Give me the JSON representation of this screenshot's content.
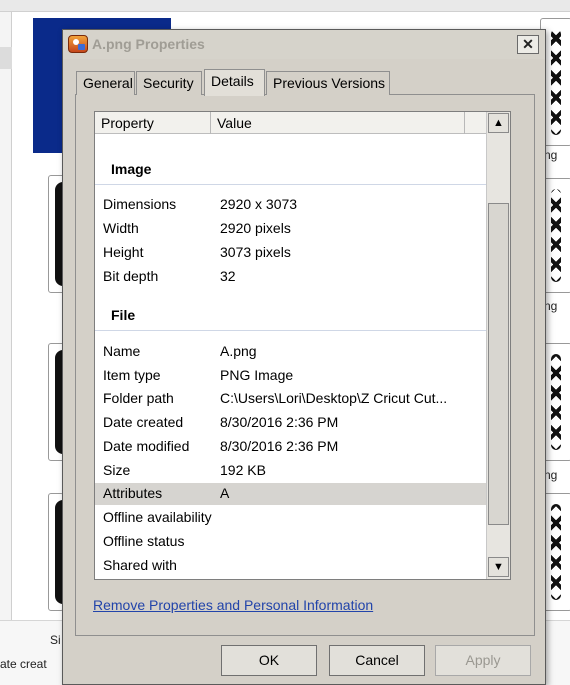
{
  "background": {
    "captions": [
      "ng",
      "ng",
      "ng"
    ],
    "bottom_left": [
      "Si",
      "ate creat"
    ]
  },
  "dialog": {
    "title": "A.png Properties",
    "close_symbol": "✕",
    "tabs": [
      {
        "label": "General"
      },
      {
        "label": "Security"
      },
      {
        "label": "Details",
        "active": true
      },
      {
        "label": "Previous Versions"
      }
    ],
    "columns": {
      "property": "Property",
      "value": "Value"
    },
    "groups": [
      {
        "title": "Image",
        "rows": [
          {
            "property": "Dimensions",
            "value": "2920 x 3073"
          },
          {
            "property": "Width",
            "value": "2920 pixels"
          },
          {
            "property": "Height",
            "value": "3073 pixels"
          },
          {
            "property": "Bit depth",
            "value": "32"
          }
        ]
      },
      {
        "title": "File",
        "rows": [
          {
            "property": "Name",
            "value": "A.png"
          },
          {
            "property": "Item type",
            "value": "PNG Image"
          },
          {
            "property": "Folder path",
            "value": "C:\\Users\\Lori\\Desktop\\Z Cricut Cut..."
          },
          {
            "property": "Date created",
            "value": "8/30/2016 2:36 PM"
          },
          {
            "property": "Date modified",
            "value": "8/30/2016 2:36 PM"
          },
          {
            "property": "Size",
            "value": "192 KB"
          },
          {
            "property": "Attributes",
            "value": "A",
            "selected": true
          },
          {
            "property": "Offline availability",
            "value": ""
          },
          {
            "property": "Offline status",
            "value": ""
          },
          {
            "property": "Shared with",
            "value": ""
          }
        ]
      }
    ],
    "remove_link": "Remove Properties and Personal Information",
    "buttons": {
      "ok": "OK",
      "cancel": "Cancel",
      "apply": "Apply"
    },
    "scroll_up_icon": "▲",
    "scroll_down_icon": "▼"
  }
}
